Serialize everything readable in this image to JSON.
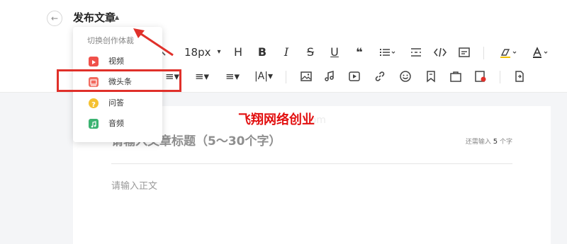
{
  "header": {
    "back_icon": "←",
    "title": "发布文章",
    "caret": "▲"
  },
  "toolbar": {
    "font_size": "18px",
    "font_caret": "▾",
    "row1": [
      {
        "name": "heading-button",
        "label": "H"
      },
      {
        "name": "bold-button",
        "label": "B"
      },
      {
        "name": "italic-button",
        "label": "I"
      },
      {
        "name": "strikethrough-button",
        "label": "S"
      },
      {
        "name": "underline-button",
        "label": "U"
      },
      {
        "name": "quote-button",
        "label": "❝"
      }
    ],
    "row2": [
      {
        "name": "align-button",
        "label": "≡▾"
      },
      {
        "name": "line-height-button",
        "label": "≡▾"
      },
      {
        "name": "indent-button",
        "label": "≡▾"
      },
      {
        "name": "letter-spacing-button",
        "label": "|A|▾"
      }
    ]
  },
  "dropdown": {
    "header": "切换创作体裁",
    "items": [
      {
        "label": "视频",
        "color": "#f0504a"
      },
      {
        "label": "微头条",
        "color": "#f26b60"
      },
      {
        "label": "问答",
        "color": "#f5c131"
      },
      {
        "label": "音频",
        "color": "#3cb371"
      }
    ]
  },
  "watermark": "飞翔网络创业",
  "ghost_text": "com",
  "editor": {
    "title_placeholder": "请输入文章标题（5～30个字）",
    "counter_prefix": "还需输入",
    "counter_value": "5",
    "counter_suffix": "个字",
    "body_placeholder": "请输入正文"
  },
  "colors": {
    "highlight": "#e0302a",
    "watermark": "#e20f0f"
  }
}
